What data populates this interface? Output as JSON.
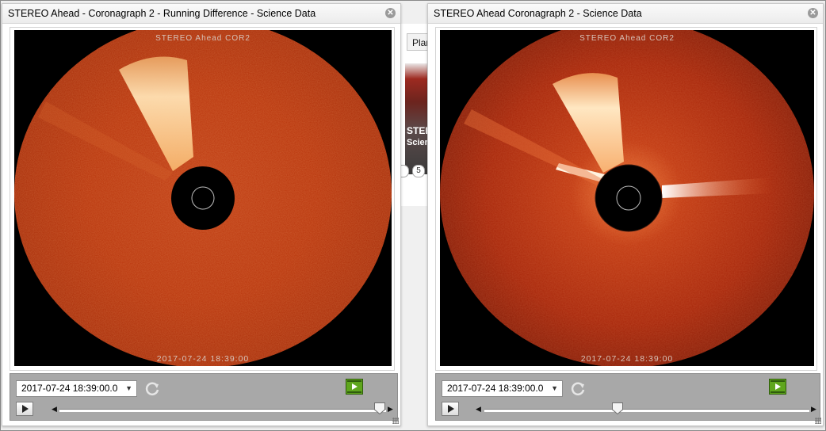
{
  "background_app": {
    "tab_label": "Planets",
    "thumb_title": "STEREO B",
    "thumb_subtitle": "Science D",
    "radio_value": "5"
  },
  "panels": [
    {
      "title": "STEREO Ahead - Coronagraph 2 - Running Difference - Science Data",
      "image": {
        "top_label": "STEREO Ahead COR2",
        "bottom_label": "2017-07-24 18:39:00",
        "style": "running-difference",
        "colors": {
          "background": "#000000",
          "disk": "#b8330a",
          "cme": "#ffe2b4",
          "occulter": "#000000"
        }
      },
      "date_value": "2017-07-24 18:39:00.0",
      "slider_position_fraction": 0.98
    },
    {
      "title": "STEREO Ahead Coronagraph 2 - Science Data",
      "image": {
        "top_label": "STEREO Ahead COR2",
        "bottom_label": "2017-07-24 18:39:00",
        "style": "science-data",
        "colors": {
          "background": "#000000",
          "disk": "#a8260a",
          "cme": "#ffe7c2",
          "occulter": "#000000"
        }
      },
      "date_value": "2017-07-24 18:39:00.0",
      "slider_position_fraction": 0.41
    }
  ],
  "icons": {
    "close": "close-icon",
    "refresh": "refresh-icon",
    "movie": "movie-icon",
    "play": "play-icon",
    "dropdown": "chevron-down-icon"
  }
}
